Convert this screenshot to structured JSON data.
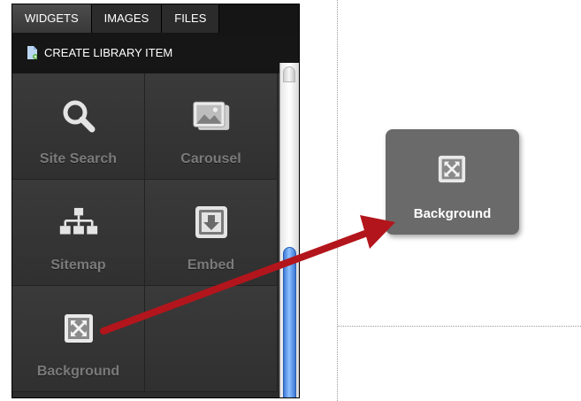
{
  "tabs": [
    {
      "label": "WIDGETS",
      "active": true
    },
    {
      "label": "IMAGES",
      "active": false
    },
    {
      "label": "FILES",
      "active": false
    }
  ],
  "create_library_item": {
    "label": "CREATE LIBRARY ITEM",
    "icon": "document-add-icon"
  },
  "widgets": [
    {
      "label": "Site Search",
      "icon": "magnifier-icon"
    },
    {
      "label": "Carousel",
      "icon": "images-icon"
    },
    {
      "label": "Sitemap",
      "icon": "sitemap-icon"
    },
    {
      "label": "Embed",
      "icon": "embed-icon"
    },
    {
      "label": "Background",
      "icon": "expand-icon"
    }
  ],
  "drag_tile": {
    "label": "Background",
    "icon": "expand-icon"
  },
  "colors": {
    "panel_bg": "#151515",
    "cell_label": "#7a7a7a",
    "arrow": "#b3151c",
    "scroll_thumb": "#4a86e0",
    "tile_bg": "#6a6a6a"
  }
}
